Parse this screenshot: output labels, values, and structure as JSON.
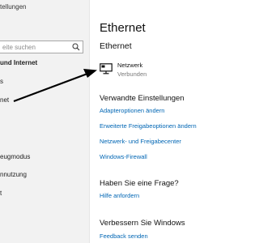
{
  "sidebar": {
    "title": "tellungen",
    "search_placeholder": "eite suchen",
    "items": [
      {
        "label": "und Internet",
        "bold": true
      },
      {
        "label": "s"
      },
      {
        "label": "net"
      },
      {
        "label": "eugmodus"
      },
      {
        "label": "nnutzung"
      },
      {
        "label": "t"
      }
    ]
  },
  "main": {
    "title": "Ethernet",
    "subtitle": "Ethernet",
    "network": {
      "name": "Netzwerk",
      "status": "Verbunden"
    },
    "related": {
      "heading": "Verwandte Einstellungen",
      "links": [
        "Adapteroptionen ändern",
        "Erweiterte Freigabeoptionen ändern",
        "Netzwerk- und Freigabecenter",
        "Windows-Firewall"
      ]
    },
    "question": {
      "heading": "Haben Sie eine Frage?",
      "link": "Hilfe anfordern"
    },
    "improve": {
      "heading": "Verbessern Sie Windows",
      "link": "Feedback senden"
    }
  },
  "colors": {
    "link": "#0066b4",
    "sidebar_bg": "#f2f2f2",
    "annotation_arrow": "#000000"
  },
  "icons": {
    "search": "search-icon",
    "network": "ethernet-monitor-icon"
  }
}
